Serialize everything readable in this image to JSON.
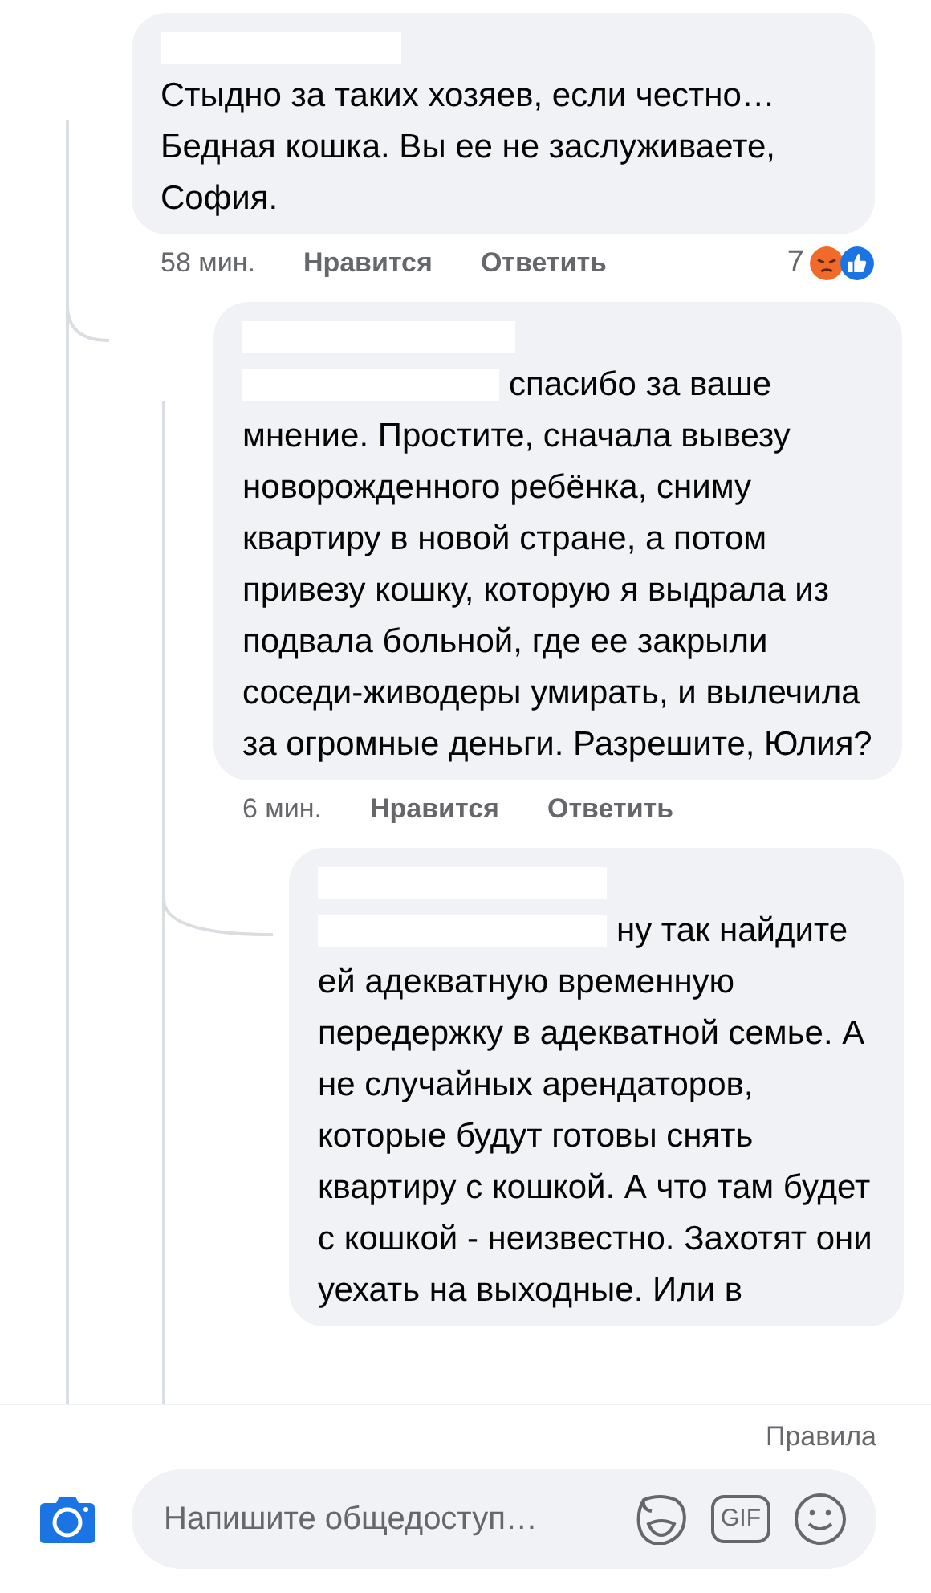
{
  "comments": [
    {
      "text": "Стыдно за таких хозяев, если честно… Бедная кошка. Вы ее не заслуживаете, София.",
      "mention": false,
      "time": "58 мин.",
      "like_label": "Нравится",
      "reply_label": "Ответить",
      "reactions_count": "7",
      "reactions": [
        {
          "kind": "angry"
        },
        {
          "kind": "like"
        }
      ],
      "replies": [
        {
          "text": "спасибо за ваше мнение. Простите, сначала вывезу новорожденного ребёнка, сниму квартиру в новой стране, а потом привезу кошку, которую я выдрала из подвала больной, где ее закрыли соседи-живодеры умирать, и вылечила за огромные деньги. Разрешите, Юлия?",
          "mention": true,
          "time": "6 мин.",
          "like_label": "Нравится",
          "reply_label": "Ответить",
          "replies": [
            {
              "text": "ну так найдите ей адекватную временную передержку в адекватной семье. А не случайных арендаторов, которые будут готовы снять квартиру с кошкой. А что там будет с кошкой - неизвестно. Захотят они уехать на выходные. Или в",
              "mention": true
            }
          ]
        }
      ]
    }
  ],
  "footer": {
    "rules_link": "Правила",
    "composer": {
      "placeholder": "Напишите общедоступ…",
      "gif_label": "GIF"
    }
  }
}
